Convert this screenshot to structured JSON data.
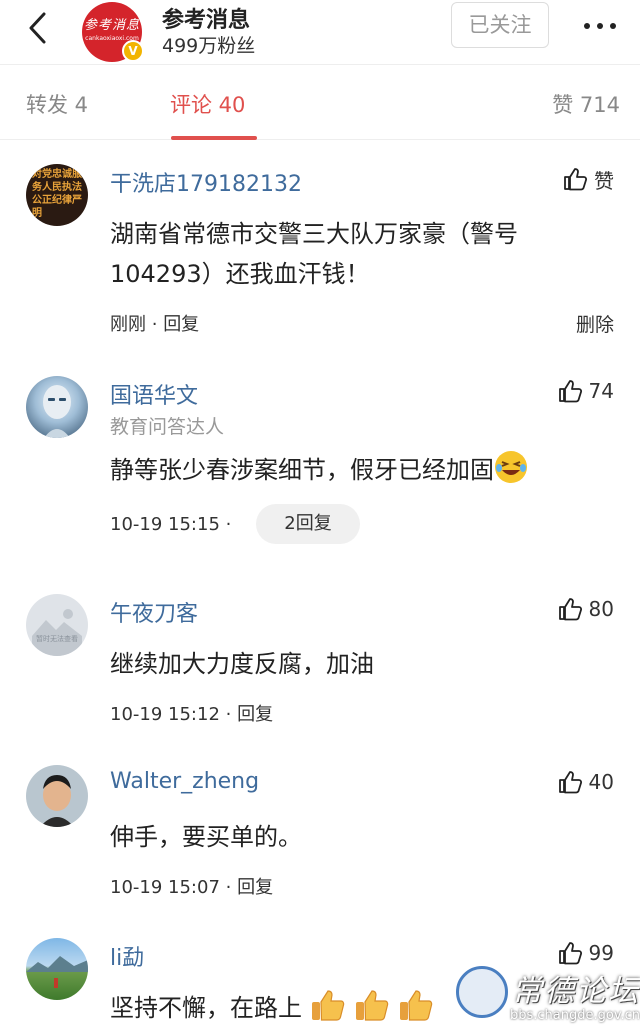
{
  "header": {
    "account_name": "参考消息",
    "fans": "499万粉丝",
    "follow_label": "已关注",
    "logo_text": "参考消息",
    "logo_sub": "cankaoxiaoxi.com",
    "verified_mark": "V"
  },
  "tabs": {
    "repost": "转发 4",
    "comments": "评论 40",
    "likes": "赞 714"
  },
  "comments": [
    {
      "name": "干洗店179182132",
      "avatar_text": "对党忠诚服务人民执法公正纪律严明",
      "text": "湖南省常德市交警三大队万家豪（警号104293）还我血汗钱！",
      "time": "刚刚",
      "reply": "回复",
      "like_label": "赞",
      "delete": "删除"
    },
    {
      "name": "国语华文",
      "subtitle": "教育问答达人",
      "text": "静等张少春涉案细节，假牙已经加固",
      "time": "10-19 15:15",
      "replies": "2回复",
      "likes": "74"
    },
    {
      "name": "午夜刀客",
      "avatar_caption": "暂时无法查看",
      "text": "继续加大力度反腐，加油",
      "time": "10-19 15:12",
      "reply": "回复",
      "likes": "80"
    },
    {
      "name": "Walter_zheng",
      "text": "伸手，要买单的。",
      "time": "10-19 15:07",
      "reply": "回复",
      "likes": "40"
    },
    {
      "name": "li勐",
      "text": "坚持不懈，在路上",
      "likes": "99"
    }
  ],
  "watermark": {
    "title": "常德论坛",
    "url": "bbs.changde.gov.cn"
  },
  "colors": {
    "accent": "#e0504d",
    "username": "#3f6b9c",
    "brand_red": "#d4242b"
  }
}
